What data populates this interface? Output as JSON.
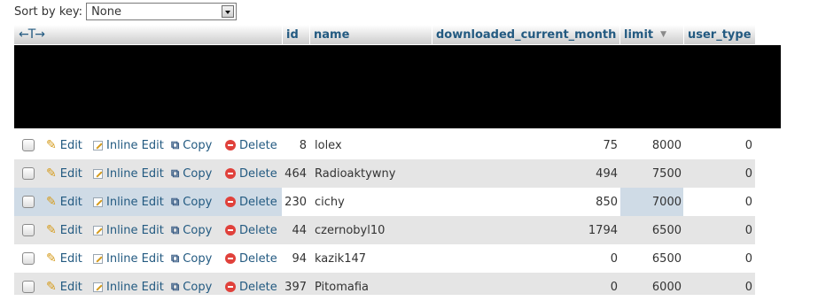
{
  "sort": {
    "label": "Sort by key:",
    "value": "None"
  },
  "columns": {
    "arrows": "←T→",
    "id": "id",
    "name": "name",
    "downloaded": "downloaded_current_month",
    "limit": "limit",
    "user_type": "user_type"
  },
  "actions": {
    "edit": "Edit",
    "inline_edit": "Inline Edit",
    "copy": "Copy",
    "delete": "Delete"
  },
  "rows": [
    {
      "id": "8",
      "name": "lolex",
      "downloaded": "75",
      "limit": "8000",
      "user_type": "0"
    },
    {
      "id": "464",
      "name": "Radioaktywny",
      "downloaded": "494",
      "limit": "7500",
      "user_type": "0"
    },
    {
      "id": "230",
      "name": "cichy",
      "downloaded": "850",
      "limit": "7000",
      "user_type": "0"
    },
    {
      "id": "44",
      "name": "czernobyl10",
      "downloaded": "1794",
      "limit": "6500",
      "user_type": "0"
    },
    {
      "id": "94",
      "name": "kazik147",
      "downloaded": "0",
      "limit": "6500",
      "user_type": "0"
    },
    {
      "id": "397",
      "name": "Pitomafia",
      "downloaded": "0",
      "limit": "6000",
      "user_type": "0"
    }
  ]
}
